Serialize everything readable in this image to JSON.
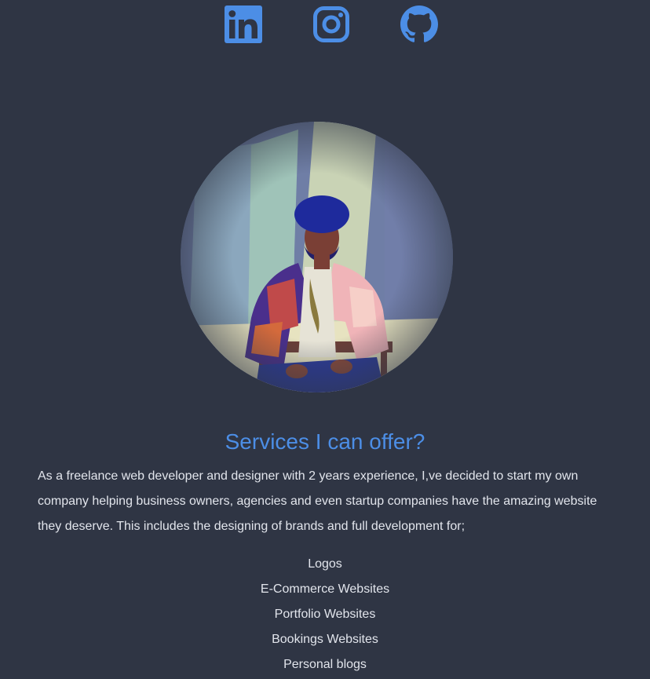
{
  "social": [
    {
      "name": "LinkedIn",
      "icon": "linkedin-icon"
    },
    {
      "name": "Instagram",
      "icon": "instagram-icon"
    },
    {
      "name": "GitHub",
      "icon": "github-icon"
    }
  ],
  "colors": {
    "background": "#2f3544",
    "accent": "#4c8ee6",
    "text": "#e2e5ec"
  },
  "profile": {
    "photo": "profile-photo"
  },
  "services": {
    "title": "Services I can offer?",
    "intro": "As a freelance web developer and designer with 2 years experience, I,ve decided to start my own company helping business owners, agencies and even startup companies have the amazing website they deserve. This includes the designing of brands and full development for;",
    "items": [
      "Logos",
      "E-Commerce Websites",
      "Portfolio Websites",
      "Bookings Websites",
      "Personal blogs"
    ]
  }
}
